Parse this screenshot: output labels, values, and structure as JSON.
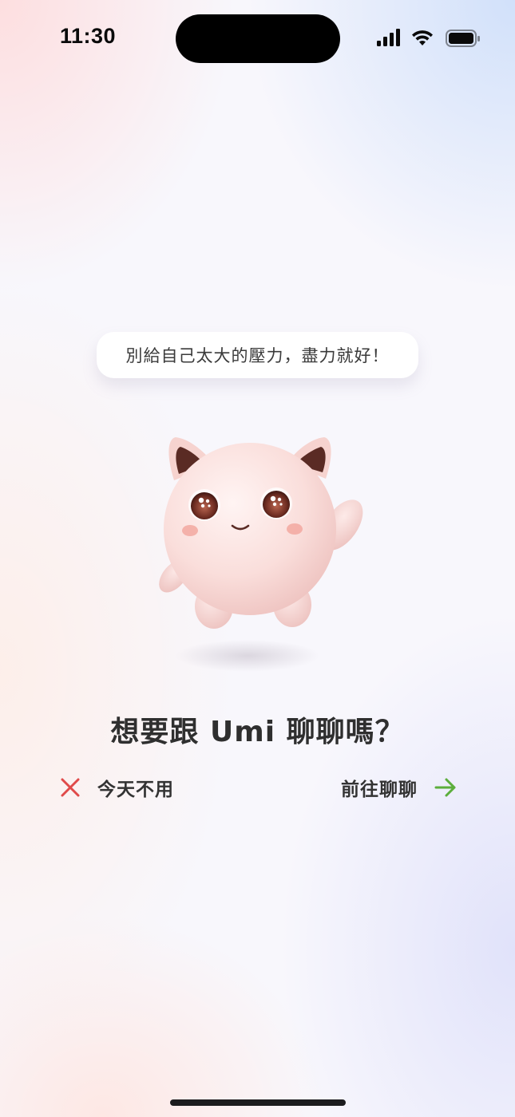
{
  "status_bar": {
    "time": "11:30"
  },
  "speech_bubble": {
    "text": "別給自己太大的壓力，盡力就好！"
  },
  "prompt": {
    "question": "想要跟 Umi 聊聊嗎？"
  },
  "actions": {
    "skip_label": "今天不用",
    "chat_label": "前往聊聊",
    "skip_icon": "close-icon",
    "chat_icon": "arrow-right-icon"
  },
  "colors": {
    "skip_icon": "#e04a4a",
    "chat_icon": "#5cae3c",
    "text_primary": "#2f2f2f"
  }
}
